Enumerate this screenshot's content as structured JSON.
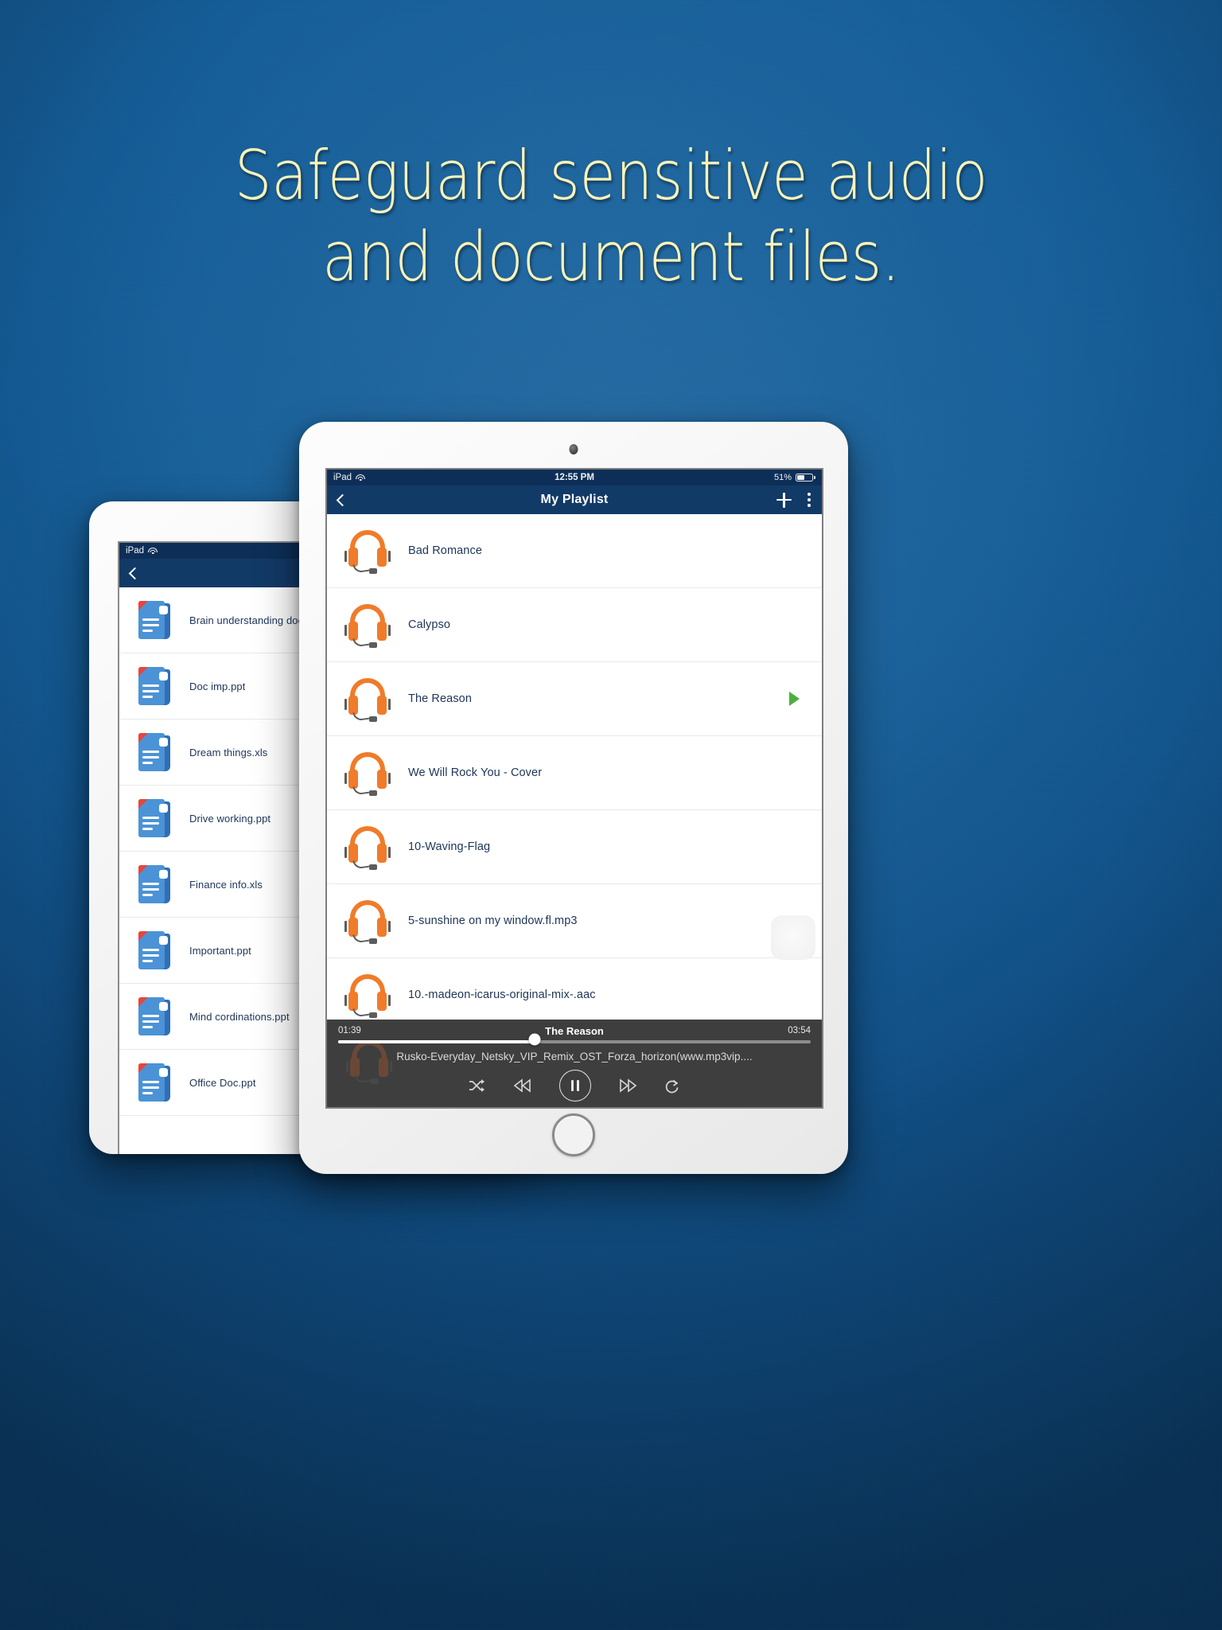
{
  "headline": {
    "line1": "Safeguard sensitive audio",
    "line2": "and document files.",
    "color": "#fbf3b8"
  },
  "background": {
    "color": "#0d4d85"
  },
  "theme": {
    "navbar_color": "#123a67",
    "statusbar_color": "#0d2f57",
    "accent_orange": "#f07b2a",
    "accent_green": "#4caf3f",
    "doc_blue": "#4b93d6",
    "doc_red": "#e8453c",
    "player_bg": "#3e3e3e"
  },
  "front_tablet": {
    "status_bar": {
      "device": "iPad",
      "wifi_icon": "wifi-icon",
      "time": "12:55 PM",
      "battery_percent": "51%",
      "battery_icon": "battery-icon"
    },
    "nav": {
      "back_icon": "chevron-left-icon",
      "title": "My Playlist",
      "add_icon": "plus-icon",
      "menu_icon": "kebab-menu-icon"
    },
    "playlist": [
      {
        "title": "Bad Romance",
        "icon": "headphones-icon",
        "playing": false
      },
      {
        "title": "Calypso",
        "icon": "headphones-icon",
        "playing": false
      },
      {
        "title": "The Reason",
        "icon": "headphones-icon",
        "playing": true
      },
      {
        "title": "We Will Rock You - Cover",
        "icon": "headphones-icon",
        "playing": false
      },
      {
        "title": "10-Waving-Flag",
        "icon": "headphones-icon",
        "playing": false
      },
      {
        "title": "5-sunshine on my window.fl.mp3",
        "icon": "headphones-icon",
        "playing": false
      },
      {
        "title": "10.-madeon-icarus-original-mix-.aac",
        "icon": "headphones-icon",
        "playing": false
      }
    ],
    "player": {
      "elapsed": "01:39",
      "now_playing": "The Reason",
      "duration": "03:54",
      "progress_percent": 42,
      "file_name": "Rusko-Everyday_Netsky_VIP_Remix_OST_Forza_horizon(www.mp3vip....",
      "controls": {
        "shuffle": "shuffle-icon",
        "previous": "previous-track-icon",
        "play_pause": "pause-icon",
        "next": "next-track-icon",
        "repeat": "repeat-icon"
      }
    }
  },
  "back_tablet": {
    "status_bar": {
      "device": "iPad",
      "wifi_icon": "wifi-icon"
    },
    "nav": {
      "back_icon": "chevron-left-icon"
    },
    "files": [
      {
        "name": "Brain understanding doc.x",
        "icon": "document-icon"
      },
      {
        "name": "Doc imp.ppt",
        "icon": "document-icon"
      },
      {
        "name": "Dream things.xls",
        "icon": "document-icon"
      },
      {
        "name": "Drive working.ppt",
        "icon": "document-icon"
      },
      {
        "name": "Finance info.xls",
        "icon": "document-icon"
      },
      {
        "name": "Important.ppt",
        "icon": "document-icon"
      },
      {
        "name": "Mind cordinations.ppt",
        "icon": "document-icon"
      },
      {
        "name": "Office Doc.ppt",
        "icon": "document-icon"
      }
    ]
  }
}
